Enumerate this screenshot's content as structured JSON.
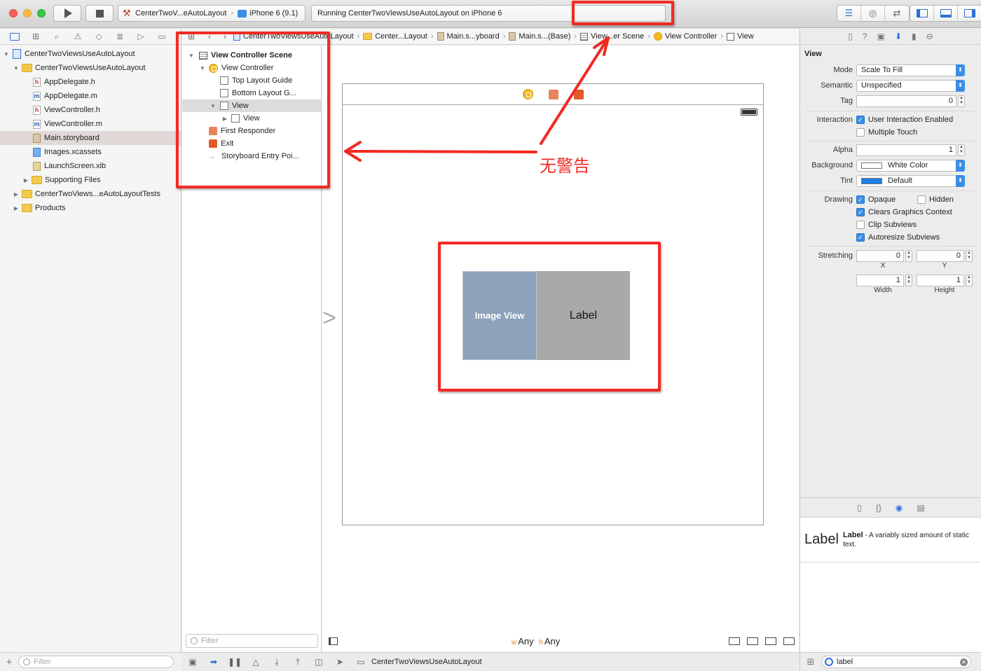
{
  "toolbar": {
    "scheme_target": "CenterTwoV...eAutoLayout",
    "scheme_device": "iPhone 6 (9.1)",
    "status_text": "Running CenterTwoViewsUseAutoLayout on iPhone 6"
  },
  "navigator": {
    "items": [
      {
        "label": "CenterTwoViewsUseAutoLayout",
        "type": "project",
        "indent": 0,
        "disclosure": "open"
      },
      {
        "label": "CenterTwoViewsUseAutoLayout",
        "type": "folder",
        "indent": 1,
        "disclosure": "open"
      },
      {
        "label": "AppDelegate.h",
        "type": "h",
        "indent": 2
      },
      {
        "label": "AppDelegate.m",
        "type": "m",
        "indent": 2
      },
      {
        "label": "ViewController.h",
        "type": "h",
        "indent": 2
      },
      {
        "label": "ViewController.m",
        "type": "m",
        "indent": 2
      },
      {
        "label": "Main.storyboard",
        "type": "storyboard",
        "indent": 2,
        "selected": true
      },
      {
        "label": "Images.xcassets",
        "type": "xcassets",
        "indent": 2
      },
      {
        "label": "LaunchScreen.xib",
        "type": "xib",
        "indent": 2
      },
      {
        "label": "Supporting Files",
        "type": "folder",
        "indent": 2,
        "disclosure": "closed"
      },
      {
        "label": "CenterTwoViews...eAutoLayoutTests",
        "type": "folder",
        "indent": 1,
        "disclosure": "closed"
      },
      {
        "label": "Products",
        "type": "folder",
        "indent": 1,
        "disclosure": "closed"
      }
    ],
    "filter_placeholder": "Filter"
  },
  "jumpbar": {
    "project": "CenterTwoViewsUseAutoLayout",
    "folder": "Center...Layout",
    "storyboard": "Main.s...yboard",
    "base": "Main.s...(Base)",
    "scene": "View...er Scene",
    "controller": "View Controller",
    "view": "View"
  },
  "outline": {
    "scene_title": "View Controller Scene",
    "view_controller": "View Controller",
    "top_guide": "Top Layout Guide",
    "bottom_guide": "Bottom Layout G...",
    "view": "View",
    "subview": "View",
    "first_responder": "First Responder",
    "exit": "Exit",
    "entry_point": "Storyboard Entry Poi...",
    "filter_placeholder": "Filter"
  },
  "canvas": {
    "image_view_label": "Image View",
    "label_text": "Label",
    "size_w_prefix": "w",
    "size_w": "Any",
    "size_h_prefix": "h",
    "size_h": "Any"
  },
  "debugbar": {
    "target": "CenterTwoViewsUseAutoLayout"
  },
  "inspector": {
    "section_title": "View",
    "mode_label": "Mode",
    "mode_value": "Scale To Fill",
    "semantic_label": "Semantic",
    "semantic_value": "Unspecified",
    "tag_label": "Tag",
    "tag_value": "0",
    "interaction_label": "Interaction",
    "user_interaction": "User Interaction Enabled",
    "multiple_touch": "Multiple Touch",
    "alpha_label": "Alpha",
    "alpha_value": "1",
    "background_label": "Background",
    "background_value": "White Color",
    "tint_label": "Tint",
    "tint_value": "Default",
    "drawing_label": "Drawing",
    "opaque": "Opaque",
    "hidden": "Hidden",
    "clears_graphics": "Clears Graphics Context",
    "clip_subviews": "Clip Subviews",
    "autoresize_subviews": "Autoresize Subviews",
    "stretching_label": "Stretching",
    "stretch_x": "0",
    "stretch_y": "0",
    "stretch_w": "1",
    "stretch_h": "1",
    "x_label": "X",
    "y_label": "Y",
    "width_label": "Width",
    "height_label": "Height"
  },
  "library": {
    "item_big": "Label",
    "item_name": "Label",
    "item_desc": " - A variably sized amount of static text.",
    "search_value": "label"
  },
  "annotation": {
    "text": "无警告",
    "color": "#f22a22"
  }
}
